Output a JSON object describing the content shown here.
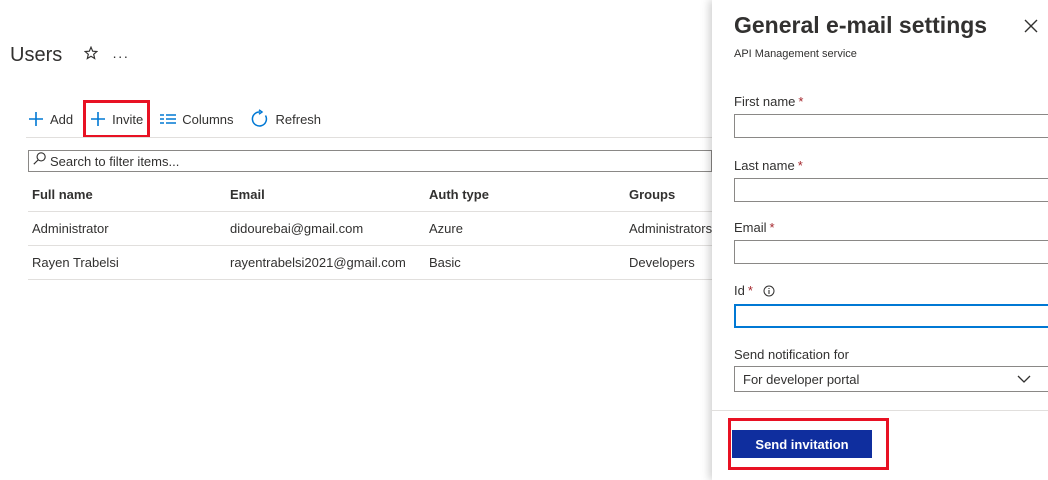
{
  "page": {
    "title": "Users",
    "star_icon": "star-icon",
    "more": "···"
  },
  "toolbar": {
    "add_label": "Add",
    "invite_label": "Invite",
    "columns_label": "Columns",
    "refresh_label": "Refresh"
  },
  "search": {
    "placeholder": "Search to filter items..."
  },
  "table": {
    "headers": [
      "Full name",
      "Email",
      "Auth type",
      "Groups"
    ],
    "rows": [
      [
        "Administrator",
        "didourebai@gmail.com",
        "Azure",
        "Administrators"
      ],
      [
        "Rayen Trabelsi",
        "rayentrabelsi2021@gmail.com",
        "Basic",
        "Developers"
      ]
    ]
  },
  "panel": {
    "title": "General e-mail settings",
    "subtitle": "API Management service",
    "first_name_label": "First name",
    "last_name_label": "Last name",
    "email_label": "Email",
    "id_label": "Id",
    "required_mark": "*",
    "notification_label": "Send notification for",
    "notification_value": "For developer portal",
    "send_label": "Send invitation"
  },
  "colors": {
    "accent": "#0078d4",
    "send_button": "#0f2e9e",
    "highlight": "#e81123"
  }
}
